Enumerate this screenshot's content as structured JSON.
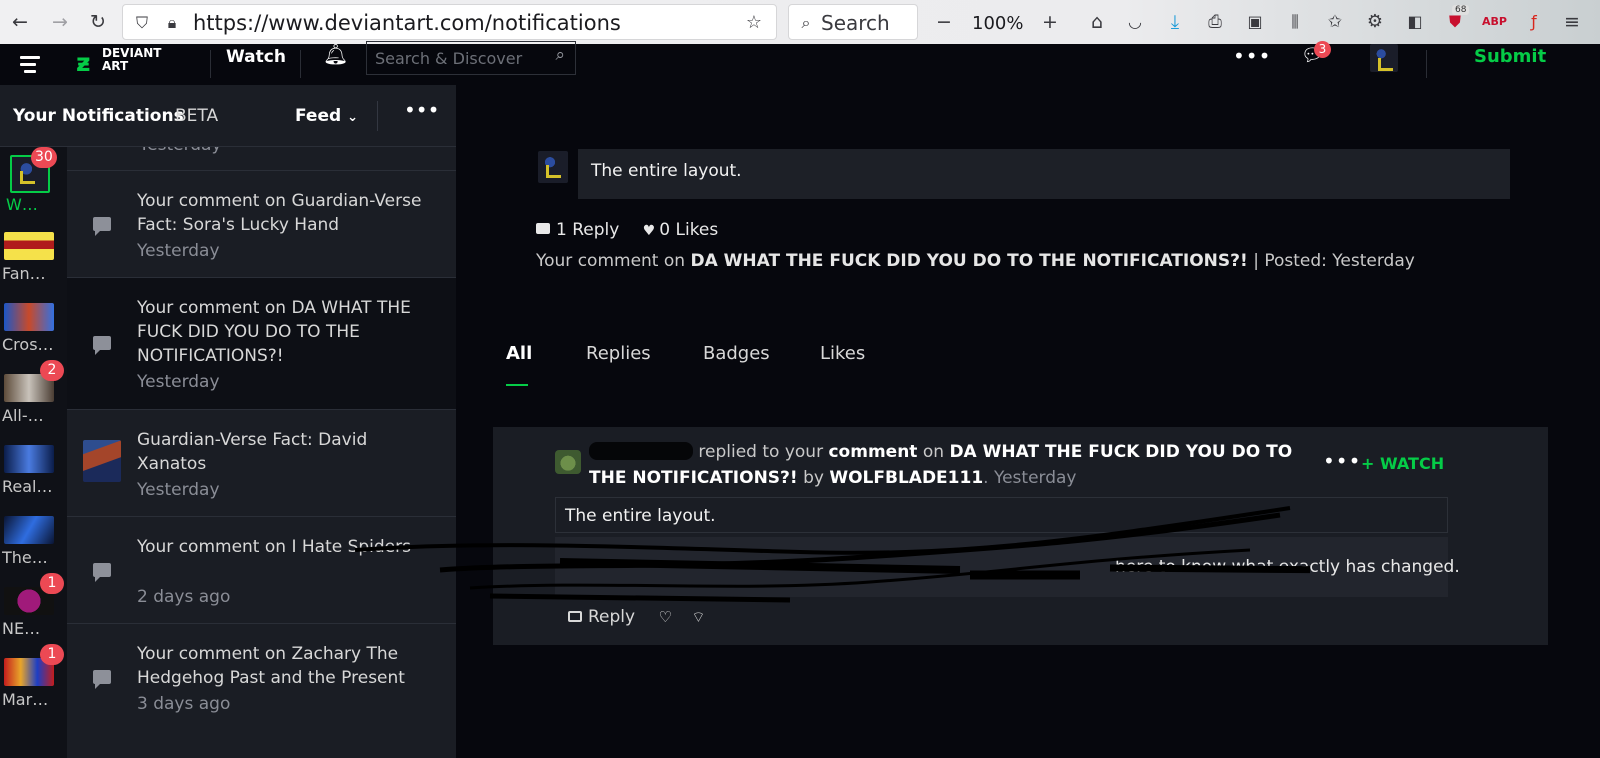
{
  "browser": {
    "url": "https://www.deviantart.com/notifications",
    "search_label": "Search",
    "zoom": "100%",
    "ext_badge_count": "68"
  },
  "topbar": {
    "watch_label": "Watch",
    "search_placeholder": "Search & Discover",
    "messages_badge": "3",
    "submit_label": "Submit"
  },
  "panel": {
    "title": "Your Notifications",
    "beta": "BETA",
    "feed_label": "Feed"
  },
  "feed_icons": [
    {
      "label": "W…",
      "badge": "30"
    },
    {
      "label": "Fan…",
      "badge": ""
    },
    {
      "label": "Cros…",
      "badge": ""
    },
    {
      "label": "All-…",
      "badge": "2"
    },
    {
      "label": "Real…",
      "badge": ""
    },
    {
      "label": "The…",
      "badge": ""
    },
    {
      "label": "NE…",
      "badge": "1"
    },
    {
      "label": "Mar…",
      "badge": "1"
    }
  ],
  "notifications": {
    "cut_time": "Yesterday",
    "items": [
      {
        "text": "Your comment on Guardian-Verse Fact: Sora's Lucky Hand",
        "time": "Yesterday"
      },
      {
        "text": "Your comment on DA WHAT THE FUCK DID YOU DO TO THE NOTIFICATIONS?!",
        "time": "Yesterday"
      },
      {
        "text": "Guardian-Verse Fact: David Xanatos",
        "time": "Yesterday"
      },
      {
        "text": "Your comment on I Hate Spiders",
        "time": "2 days ago"
      },
      {
        "text": "Your comment on Zachary The Hedgehog Past and the Present",
        "time": "3 days ago"
      }
    ]
  },
  "detail": {
    "comment_text": "The entire layout.",
    "reply_count": "1 Reply",
    "like_count": "0 Likes",
    "meta_prefix": "Your comment on",
    "meta_title": "DA WHAT THE FUCK DID YOU DO TO THE NOTIFICATIONS?!",
    "meta_posted": "|  Posted: Yesterday"
  },
  "tabs": [
    "All",
    "Replies",
    "Badges",
    "Likes"
  ],
  "reply": {
    "action_text": "replied to your",
    "comment_word": "comment",
    "on_word": "on",
    "title": "DA WHAT THE FUCK DID YOU DO TO THE NOTIFICATIONS?!",
    "by_word": "by",
    "author": "WOLFBLADE111",
    "time": ". Yesterday",
    "watch_label": "+ WATCH",
    "quote": "The entire layout.",
    "body_visible": "here to know what exactly has changed.",
    "reply_label": "Reply"
  },
  "colors": {
    "accent": "#05cc47",
    "badge": "#ec4954",
    "panel_bg": "#1a1d24",
    "page_bg": "#06070d"
  },
  "icons": [
    "back-icon",
    "forward-icon",
    "reload-icon",
    "shield-icon",
    "lock-icon",
    "star-icon",
    "hamburger-icon",
    "bell-icon",
    "search-icon",
    "chat-icon",
    "close-icon",
    "heart-icon",
    "comment-icon"
  ]
}
